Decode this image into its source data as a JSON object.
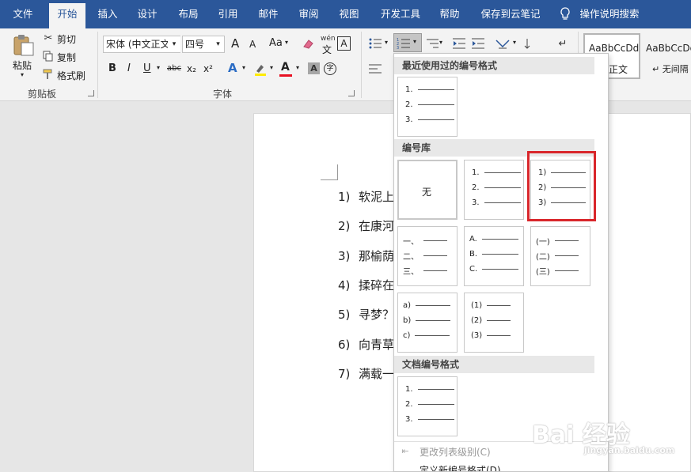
{
  "ribbon_tabs": [
    "文件",
    "开始",
    "插入",
    "设计",
    "布局",
    "引用",
    "邮件",
    "审阅",
    "视图",
    "开发工具",
    "帮助",
    "保存到云笔记",
    "操作说明搜索"
  ],
  "clipboard": {
    "paste": "粘贴",
    "cut": "剪切",
    "copy": "复制",
    "format_painter": "格式刷",
    "group_label": "剪贴板"
  },
  "font": {
    "name": "宋体 (中文正文)",
    "size": "四号",
    "group_label": "字体",
    "bold": "B",
    "italic": "I",
    "underline": "U",
    "strike": "abc",
    "sub": "x₂",
    "sup": "x²",
    "grow": "A",
    "shrink": "A",
    "case": "Aa",
    "font_color_letter": "A",
    "char_shade": "A",
    "wen": "文",
    "pinyin": "wén",
    "circle": "字"
  },
  "styles": {
    "style1_preview": "AaBbCcDd",
    "style1_name": "正文",
    "style2_preview": "AaBbCcDd",
    "style2_name": "↵ 无间隔"
  },
  "dropdown": {
    "recent_header": "最近使用过的编号格式",
    "library_header": "编号库",
    "document_header": "文档编号格式",
    "none_label": "无",
    "recent": [
      "1.",
      "2.",
      "3."
    ],
    "library": [
      [
        "1.",
        "2.",
        "3."
      ],
      [
        "1)",
        "2)",
        "3)"
      ],
      [
        "一、",
        "二、",
        "三、"
      ],
      [
        "A.",
        "B.",
        "C."
      ],
      [
        "(一)",
        "(二)",
        "(三)"
      ],
      [
        "a)",
        "b)",
        "c)"
      ],
      [
        "(1)",
        "(2)",
        "(3)"
      ]
    ],
    "document": [
      "1.",
      "2.",
      "3."
    ],
    "change_level": "更改列表级别(C)",
    "define_new": "定义新编号格式(D)..."
  },
  "document_lines": [
    {
      "num": "1)",
      "text": "软泥上"
    },
    {
      "num": "2)",
      "text": "在康河"
    },
    {
      "num": "3)",
      "text": "那榆荫"
    },
    {
      "num": "4)",
      "text": "揉碎在"
    },
    {
      "num": "5)",
      "text": "寻梦？"
    },
    {
      "num": "6)",
      "text": "向青草"
    },
    {
      "num": "7)",
      "text": "满载一"
    }
  ],
  "watermark": {
    "logo": "Bai 经验",
    "url": "jingyan.baidu.com"
  },
  "colors": {
    "ribbon_blue": "#2b579a",
    "highlight_red": "#d9262b",
    "font_color_bar": "#e81123"
  }
}
